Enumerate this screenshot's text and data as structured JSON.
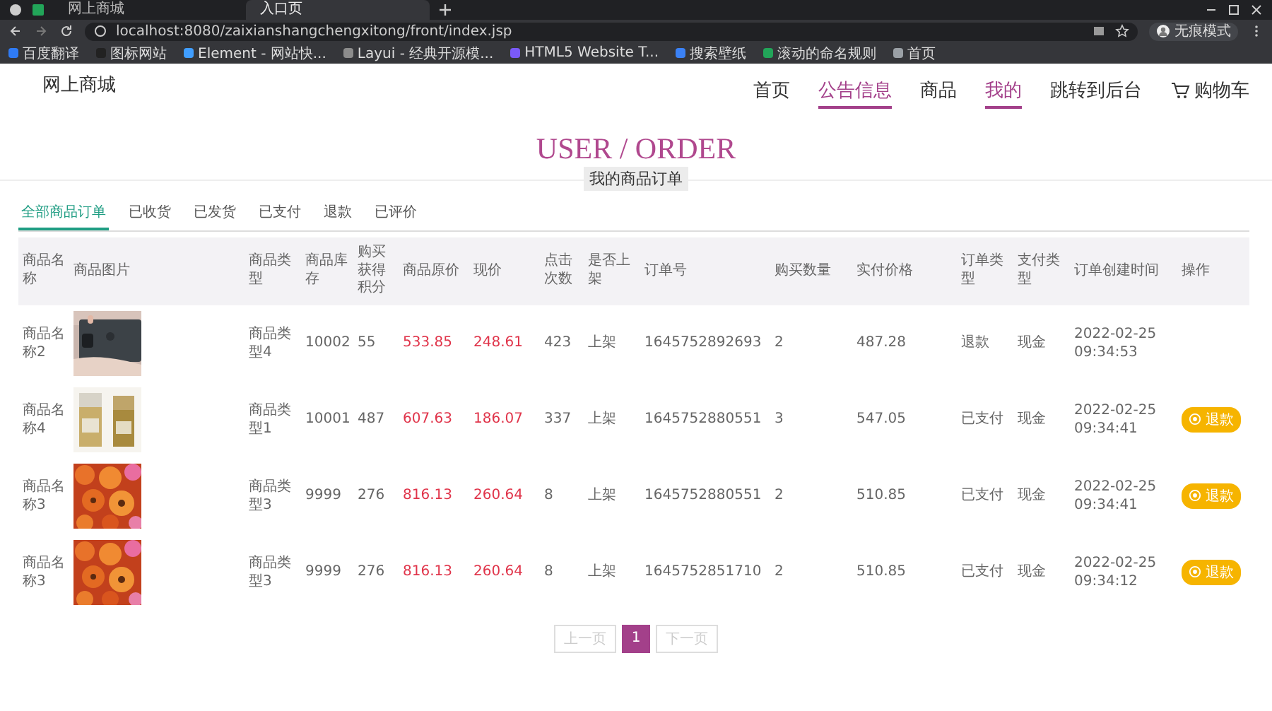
{
  "browser": {
    "tabs": [
      {
        "title": "网上商城",
        "selected": false
      },
      {
        "title": "入口页",
        "selected": true
      }
    ],
    "url": "localhost:8080/zaixianshangchengxitong/front/index.jsp",
    "bookmarks": [
      {
        "label": "百度翻译",
        "color": "#2f7bf5"
      },
      {
        "label": "图标网站",
        "color": "#222222"
      },
      {
        "label": "Element - 网站快...",
        "color": "#409eff"
      },
      {
        "label": "Layui - 经典开源模...",
        "color": "#8c8c8c"
      },
      {
        "label": "HTML5 Website T...",
        "color": "#7a5af8"
      },
      {
        "label": "搜索壁纸",
        "color": "#3b82f6"
      },
      {
        "label": "滚动的命名规则",
        "color": "#22a559"
      },
      {
        "label": "首页",
        "color": "#9aa0a6"
      }
    ],
    "profile": "无痕模式"
  },
  "site": {
    "logo": "网上商城",
    "nav": [
      {
        "label": "首页",
        "selected": false,
        "kind": "link"
      },
      {
        "label": "公告信息",
        "selected": true,
        "kind": "link"
      },
      {
        "label": "商品",
        "selected": false,
        "kind": "link"
      },
      {
        "label": "我的",
        "selected": true,
        "kind": "link"
      },
      {
        "label": "跳转到后台",
        "selected": false,
        "kind": "link"
      },
      {
        "label": "购物车",
        "selected": false,
        "kind": "cart"
      }
    ]
  },
  "heading": "USER / ORDER",
  "subheading": "我的商品订单",
  "order_tabs": [
    {
      "label": "全部商品订单",
      "selected": true
    },
    {
      "label": "已收货",
      "selected": false
    },
    {
      "label": "已发货",
      "selected": false
    },
    {
      "label": "已支付",
      "selected": false
    },
    {
      "label": "退款",
      "selected": false
    },
    {
      "label": "已评价",
      "selected": false
    }
  ],
  "table": {
    "columns": [
      "商品名称",
      "商品图片",
      "商品类型",
      "商品库存",
      "购买获得积分",
      "商品原价",
      "现价",
      "点击次数",
      "是否上架",
      "订单号",
      "购买数量",
      "实付价格",
      "订单类型",
      "支付类型",
      "订单创建时间",
      "操作"
    ],
    "rows": [
      {
        "name": "商品名称2",
        "type": "商品类型4",
        "stock": "10002",
        "points": "55",
        "original_price": "533.85",
        "price": "248.61",
        "clicks": "423",
        "shelf": "上架",
        "order_no": "1645752892693",
        "quantity": "2",
        "paid": "487.28",
        "order_type": "退款",
        "pay_type": "现金",
        "created": "2022-02-25 09:34:53"
      },
      {
        "name": "商品名称4",
        "type": "商品类型1",
        "stock": "10001",
        "points": "487",
        "original_price": "607.63",
        "price": "186.07",
        "clicks": "337",
        "shelf": "上架",
        "order_no": "1645752880551",
        "quantity": "3",
        "paid": "547.05",
        "order_type": "已支付",
        "pay_type": "现金",
        "created": "2022-02-25 09:34:41",
        "action": "退款"
      },
      {
        "name": "商品名称3",
        "type": "商品类型3",
        "stock": "9999",
        "points": "276",
        "original_price": "816.13",
        "price": "260.64",
        "clicks": "8",
        "shelf": "上架",
        "order_no": "1645752880551",
        "quantity": "2",
        "paid": "510.85",
        "order_type": "已支付",
        "pay_type": "现金",
        "created": "2022-02-25 09:34:41",
        "action": "退款"
      },
      {
        "name": "商品名称3",
        "type": "商品类型3",
        "stock": "9999",
        "points": "276",
        "original_price": "816.13",
        "price": "260.64",
        "clicks": "8",
        "shelf": "上架",
        "order_no": "1645752851710",
        "quantity": "2",
        "paid": "510.85",
        "order_type": "已支付",
        "pay_type": "现金",
        "created": "2022-02-25 09:34:12",
        "action": "退款"
      }
    ]
  },
  "pagination": {
    "prev": "上一页",
    "pages": [
      {
        "label": "1",
        "selected": true
      }
    ],
    "next": "下一页"
  }
}
